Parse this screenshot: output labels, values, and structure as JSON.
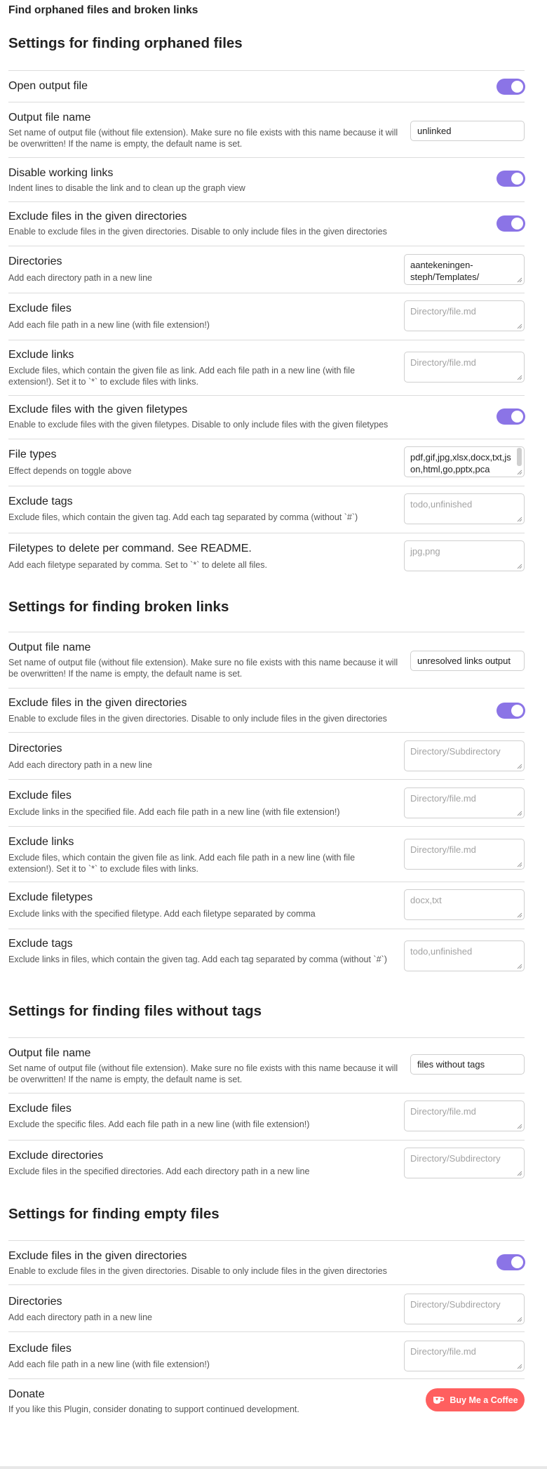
{
  "header": {
    "title": "Find orphaned files and broken links"
  },
  "colors": {
    "accent": "#8b74e6",
    "coffee_button": "#ff5f5f"
  },
  "icons": {
    "resize": "resize-grip-icon",
    "coffee": "coffee-cup-icon"
  },
  "orphaned": {
    "title": "Settings for finding orphaned files",
    "open_output": {
      "name": "Open output file",
      "enabled": true
    },
    "output_file": {
      "name": "Output file name",
      "desc": "Set name of output file (without file extension). Make sure no file exists with this name because it will be overwritten! If the name is empty, the default name is set.",
      "value": "unlinked"
    },
    "disable_links": {
      "name": "Disable working links",
      "desc": "Indent lines to disable the link and to clean up the graph view",
      "enabled": true
    },
    "exclude_dirs_toggle": {
      "name": "Exclude files in the given directories",
      "desc": "Enable to exclude files in the given directories. Disable to only include files in the given directories",
      "enabled": true
    },
    "directories": {
      "name": "Directories",
      "desc": "Add each directory path in a new line",
      "value": "aantekeningen-steph/Templates/"
    },
    "exclude_files": {
      "name": "Exclude files",
      "desc": "Add each file path in a new line (with file extension!)",
      "placeholder": "Directory/file.md"
    },
    "exclude_links": {
      "name": "Exclude links",
      "desc": "Exclude files, which contain the given file as link. Add each file path in a new line (with file extension!). Set it to `*` to exclude files with links.",
      "placeholder": "Directory/file.md"
    },
    "exclude_filetypes_toggle": {
      "name": "Exclude files with the given filetypes",
      "desc": "Enable to exclude files with the given filetypes. Disable to only include files with the given filetypes",
      "enabled": true
    },
    "file_types": {
      "name": "File types",
      "desc": "Effect depends on toggle above",
      "value": "pdf,gif,jpg,xlsx,docx,txt,json,html,go,pptx,pca"
    },
    "exclude_tags": {
      "name": "Exclude tags",
      "desc": "Exclude files, which contain the given tag. Add each tag separated by comma (without `#`)",
      "placeholder": "todo,unfinished"
    },
    "delete_filetypes": {
      "name": "Filetypes to delete per command. See README.",
      "desc": "Add each filetype separated by comma. Set to `*` to delete all files.",
      "placeholder": "jpg,png"
    }
  },
  "broken": {
    "title": "Settings for finding broken links",
    "output_file": {
      "name": "Output file name",
      "desc": "Set name of output file (without file extension). Make sure no file exists with this name because it will be overwritten! If the name is empty, the default name is set.",
      "value": "unresolved links output"
    },
    "exclude_dirs_toggle": {
      "name": "Exclude files in the given directories",
      "desc": "Enable to exclude files in the given directories. Disable to only include files in the given directories",
      "enabled": true
    },
    "directories": {
      "name": "Directories",
      "desc": "Add each directory path in a new line",
      "placeholder": "Directory/Subdirectory"
    },
    "exclude_files": {
      "name": "Exclude files",
      "desc": "Exclude links in the specified file. Add each file path in a new line (with file extension!)",
      "placeholder": "Directory/file.md"
    },
    "exclude_links": {
      "name": "Exclude links",
      "desc": "Exclude files, which contain the given file as link. Add each file path in a new line (with file extension!). Set it to `*` to exclude files with links.",
      "placeholder": "Directory/file.md"
    },
    "exclude_filetypes": {
      "name": "Exclude filetypes",
      "desc": "Exclude links with the specified filetype. Add each filetype separated by comma",
      "placeholder": "docx,txt"
    },
    "exclude_tags": {
      "name": "Exclude tags",
      "desc": "Exclude links in files, which contain the given tag. Add each tag separated by comma (without `#`)",
      "placeholder": "todo,unfinished"
    }
  },
  "no_tags": {
    "title": "Settings for finding files without tags",
    "output_file": {
      "name": "Output file name",
      "desc": "Set name of output file (without file extension). Make sure no file exists with this name because it will be overwritten! If the name is empty, the default name is set.",
      "value": "files without tags"
    },
    "exclude_files": {
      "name": "Exclude files",
      "desc": "Exclude the specific files. Add each file path in a new line (with file extension!)",
      "placeholder": "Directory/file.md"
    },
    "exclude_dirs": {
      "name": "Exclude directories",
      "desc": "Exclude files in the specified directories. Add each directory path in a new line",
      "placeholder": "Directory/Subdirectory"
    }
  },
  "empty": {
    "title": "Settings for finding empty files",
    "exclude_dirs_toggle": {
      "name": "Exclude files in the given directories",
      "desc": "Enable to exclude files in the given directories. Disable to only include files in the given directories",
      "enabled": true
    },
    "directories": {
      "name": "Directories",
      "desc": "Add each directory path in a new line",
      "placeholder": "Directory/Subdirectory"
    },
    "exclude_files": {
      "name": "Exclude files",
      "desc": "Add each file path in a new line (with file extension!)",
      "placeholder": "Directory/file.md"
    }
  },
  "donate": {
    "name": "Donate",
    "desc": "If you like this Plugin, consider donating to support continued development.",
    "button_label": "Buy Me a Coffee"
  }
}
